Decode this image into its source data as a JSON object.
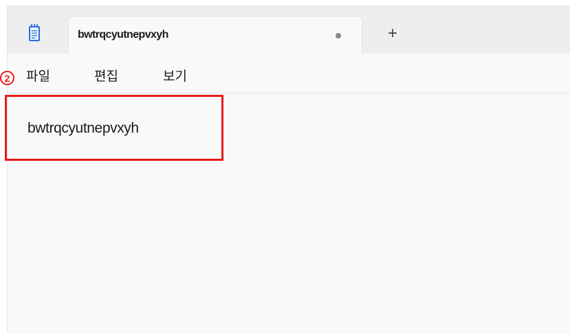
{
  "tab": {
    "title": "bwtrqcyutnepvxyh",
    "new_tab_label": "+"
  },
  "menu": {
    "items": [
      "파일",
      "편집",
      "보기"
    ]
  },
  "editor": {
    "content": "bwtrqcyutnepvxyh"
  },
  "annotation": {
    "marker": "2",
    "color": "#e81919"
  },
  "icons": {
    "app": "notepad-icon",
    "unsaved": "unsaved-dot-icon",
    "add": "plus-icon"
  }
}
